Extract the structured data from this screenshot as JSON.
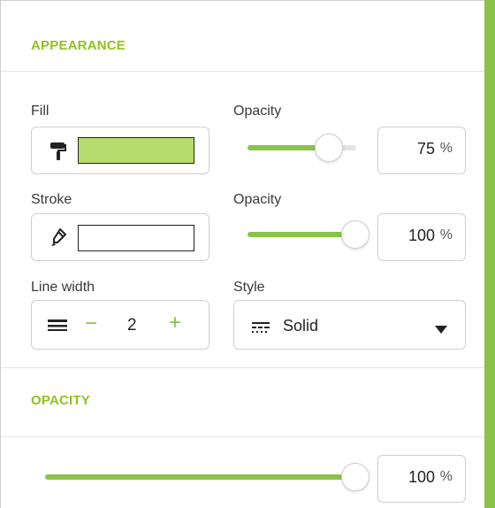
{
  "colors": {
    "accent": "#8bc34a",
    "title": "#8fc31f",
    "fill_swatch": "#b5dc6c",
    "stroke_swatch": "#ffffff"
  },
  "appearance": {
    "title": "APPEARANCE",
    "fill": {
      "label": "Fill",
      "icon": "paint-roller-icon"
    },
    "fill_opacity": {
      "label": "Opacity",
      "value": "75",
      "unit": "%",
      "level": 0.75
    },
    "stroke": {
      "label": "Stroke",
      "icon": "marker-pen-icon"
    },
    "stroke_opacity": {
      "label": "Opacity",
      "value": "100",
      "unit": "%",
      "level": 1.0
    },
    "line_width": {
      "label": "Line width",
      "icon": "line-weight-icon",
      "minus": "−",
      "value": "2",
      "plus": "+"
    },
    "style": {
      "label": "Style",
      "icon": "dash-style-icon",
      "value": "Solid",
      "chevron": "caret-down-icon"
    }
  },
  "opacity_section": {
    "title": "OPACITY",
    "opacity": {
      "value": "100",
      "unit": "%",
      "level": 1.0
    }
  }
}
